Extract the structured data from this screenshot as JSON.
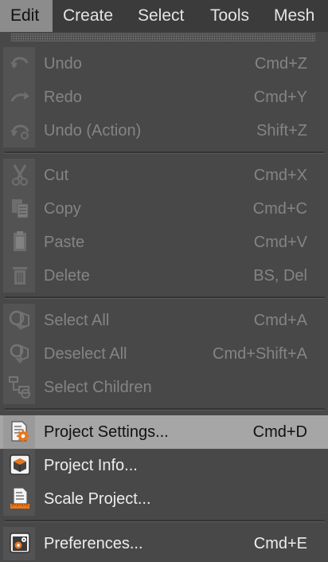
{
  "menubar": {
    "items": [
      {
        "label": "Edit",
        "active": true
      },
      {
        "label": "Create"
      },
      {
        "label": "Select"
      },
      {
        "label": "Tools"
      },
      {
        "label": "Mesh"
      }
    ]
  },
  "menu": {
    "items": [
      {
        "label": "Undo",
        "shortcut": "Cmd+Z",
        "icon": "undo-icon",
        "enabled": false
      },
      {
        "label": "Redo",
        "shortcut": "Cmd+Y",
        "icon": "redo-icon",
        "enabled": false
      },
      {
        "label": "Undo (Action)",
        "shortcut": "Shift+Z",
        "icon": "undo-action-icon",
        "enabled": false
      },
      {
        "label": "Cut",
        "shortcut": "Cmd+X",
        "icon": "scissors-icon",
        "enabled": false
      },
      {
        "label": "Copy",
        "shortcut": "Cmd+C",
        "icon": "copy-icon",
        "enabled": false
      },
      {
        "label": "Paste",
        "shortcut": "Cmd+V",
        "icon": "paste-icon",
        "enabled": false
      },
      {
        "label": "Delete",
        "shortcut": "BS, Del",
        "icon": "trash-icon",
        "enabled": false
      },
      {
        "label": "Select All",
        "shortcut": "Cmd+A",
        "icon": "select-all-icon",
        "enabled": false
      },
      {
        "label": "Deselect All",
        "shortcut": "Cmd+Shift+A",
        "icon": "deselect-all-icon",
        "enabled": false
      },
      {
        "label": "Select Children",
        "shortcut": "",
        "icon": "select-children-icon",
        "enabled": false
      },
      {
        "label": "Project Settings...",
        "shortcut": "Cmd+D",
        "icon": "project-settings-icon",
        "enabled": true,
        "highlighted": true
      },
      {
        "label": "Project Info...",
        "shortcut": "",
        "icon": "project-info-icon",
        "enabled": true
      },
      {
        "label": "Scale Project...",
        "shortcut": "",
        "icon": "scale-project-icon",
        "enabled": true
      },
      {
        "label": "Preferences...",
        "shortcut": "Cmd+E",
        "icon": "preferences-icon",
        "enabled": true
      }
    ]
  },
  "colors": {
    "background": "#484848",
    "menubar": "#3b3b3b",
    "highlight": "#a6a6a6",
    "disabled_text": "#848484",
    "enabled_text": "#ededed",
    "accent_orange": "#e8761e"
  }
}
